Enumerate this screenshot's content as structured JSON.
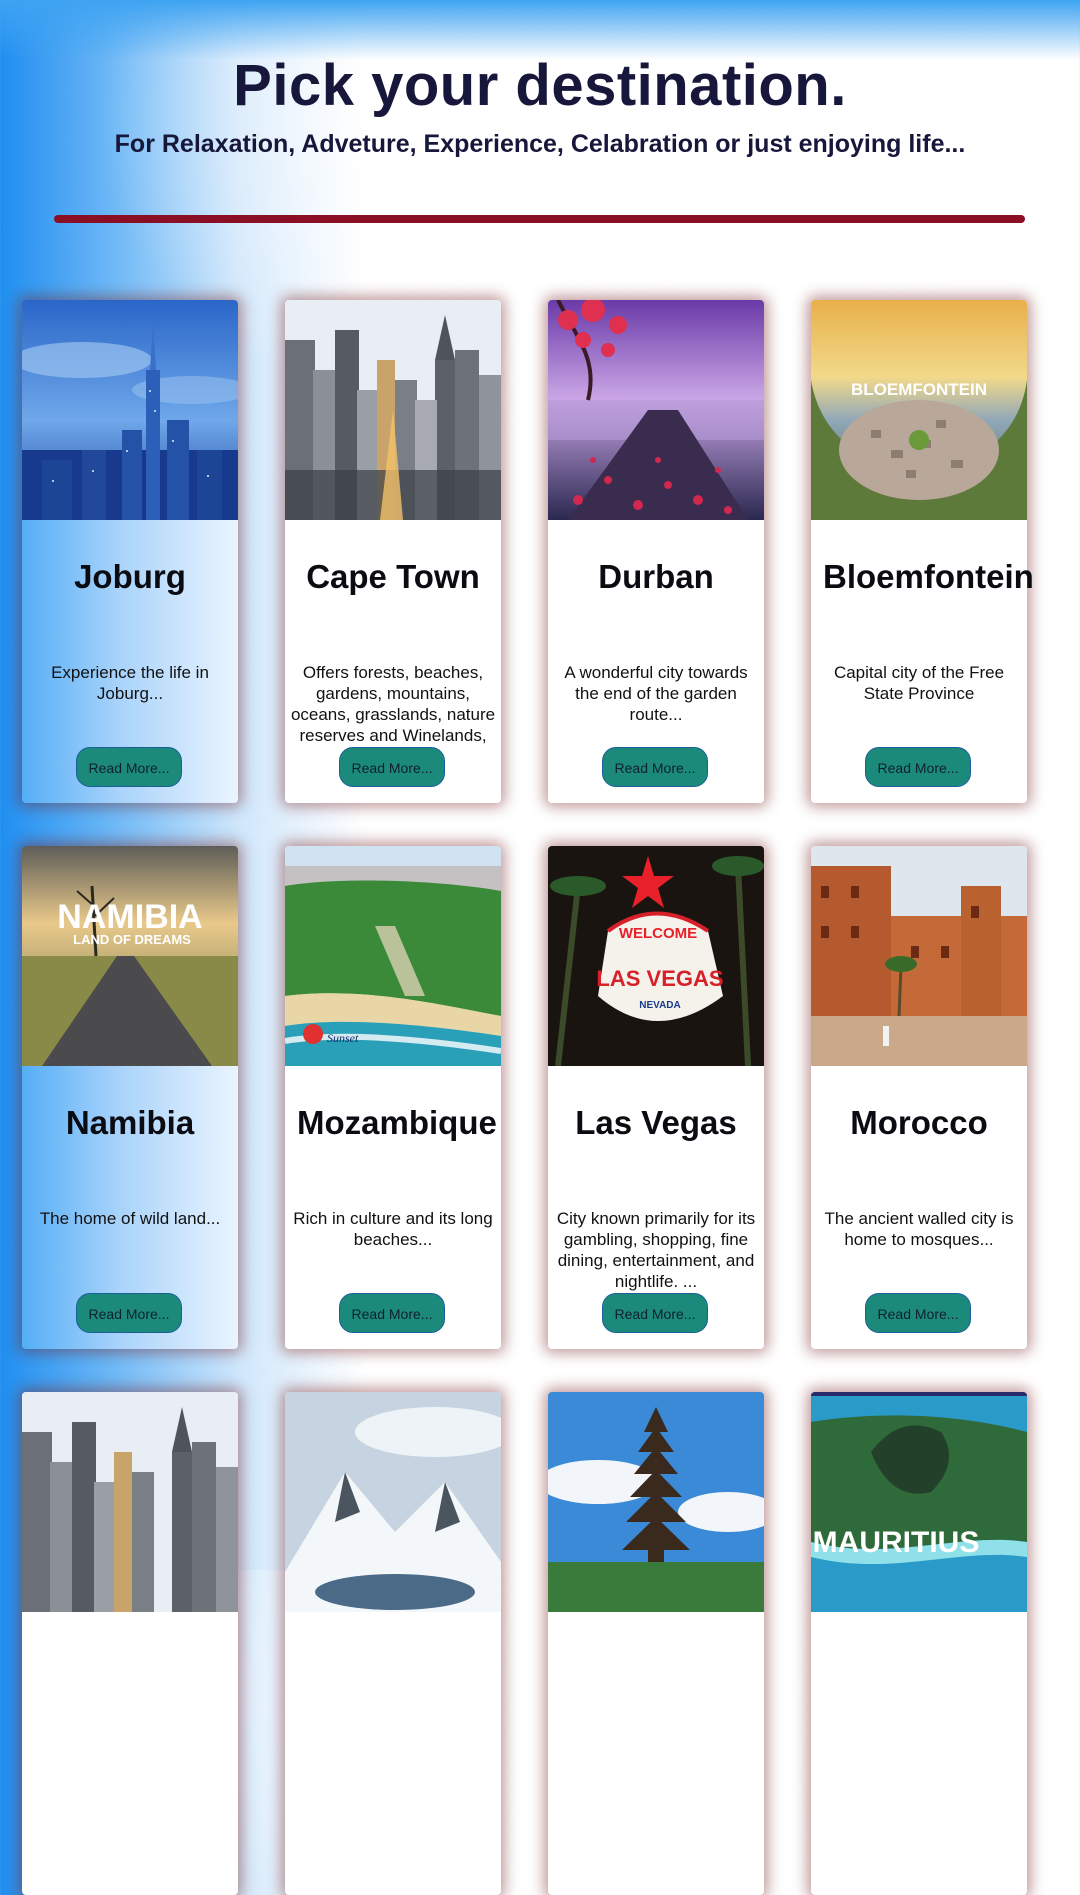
{
  "header": {
    "title": "Pick your destination.",
    "subtitle": "For Relaxation, Adveture, Experience, Celabration or just enjoying life..."
  },
  "cards": [
    {
      "name": "Joburg",
      "description": "Experience the life in Joburg...",
      "button": "Read More...",
      "image": "night-skyline-photo"
    },
    {
      "name": "Cape Town",
      "description": "Offers forests, beaches, gardens, mountains, oceans, grasslands, nature reserves and Winelands,",
      "button": "Read More...",
      "image": "city-skyscrapers-photo"
    },
    {
      "name": "Durban",
      "description": "A wonderful city towards the end of the garden route...",
      "button": "Read More...",
      "image": "lake-blossom-photo"
    },
    {
      "name": "Bloemfontein",
      "description": "Capital city of the Free State Province",
      "button": "Read More...",
      "image": "city-aerial-photo",
      "image_text": "BLOEMFONTEIN"
    },
    {
      "name": "Namibia",
      "description": "The home of wild land...",
      "button": "Read More...",
      "image": "savanna-road-photo",
      "image_text": "NAMIBIA",
      "image_subtext": "LAND OF DREAMS"
    },
    {
      "name": "Mozambique",
      "description": "Rich in culture and its long beaches...",
      "button": "Read More...",
      "image": "coastline-photo",
      "image_text": "Sunset"
    },
    {
      "name": "Las Vegas",
      "description": "City known primarily for its gambling, shopping, fine dining, entertainment, and nightlife. ...",
      "button": "Read More...",
      "image": "welcome-sign-photo",
      "image_text": "WELCOME",
      "image_subtext": "LAS VEGAS",
      "image_small": "NEVADA"
    },
    {
      "name": "Morocco",
      "description": "The ancient walled city is home to mosques...",
      "button": "Read More...",
      "image": "kasbah-photo"
    },
    {
      "name": "",
      "description": "",
      "button": "",
      "image": "city-skyscrapers-photo"
    },
    {
      "name": "",
      "description": "",
      "button": "",
      "image": "snowy-mountain-photo"
    },
    {
      "name": "",
      "description": "",
      "button": "",
      "image": "temple-photo"
    },
    {
      "name": "",
      "description": "",
      "button": "",
      "image": "island-aerial-photo",
      "image_text": "MAURITIUS"
    }
  ],
  "colors": {
    "divider": "#8a0f24",
    "button": "#1b8a7a",
    "title": "#16173a"
  }
}
